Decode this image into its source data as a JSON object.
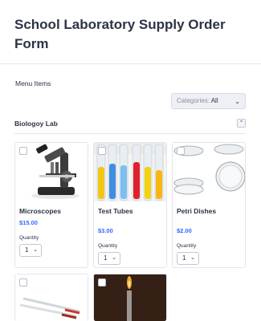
{
  "form": {
    "title": "School Laboratory Supply Order Form"
  },
  "menu": {
    "label": "Menu Items"
  },
  "filter": {
    "prefix": "Categories:",
    "value": "All"
  },
  "section": {
    "title": "Biologoy Lab"
  },
  "qty_label": "Quantity",
  "products": [
    {
      "name": "Microscopes",
      "price": "$15.00",
      "quantity": "1"
    },
    {
      "name": "Test Tubes",
      "price": "$3.00",
      "quantity": "1"
    },
    {
      "name": "Petri Dishes",
      "price": "$2.00",
      "quantity": "1"
    }
  ],
  "icons": {
    "chevron": "chevron-down-icon",
    "collapse": "chevron-up-icon"
  },
  "colors": {
    "price": "#2e69ff",
    "title": "#2c3345",
    "border": "#e3e5ea"
  }
}
